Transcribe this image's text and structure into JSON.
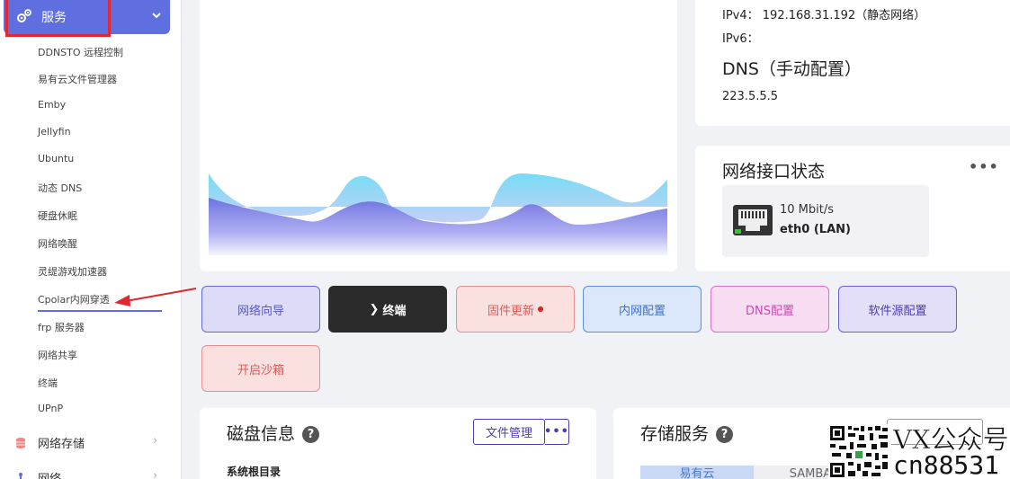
{
  "sidebar": {
    "active_label": "服务",
    "sub_items": [
      "DDNSTO 远程控制",
      "易有云文件管理器",
      "Emby",
      "Jellyfin",
      "Ubuntu",
      "动态 DNS",
      "硬盘休眠",
      "网络唤醒",
      "灵缇游戏加速器",
      "Cpolar内网穿透",
      "frp 服务器",
      "网络共享",
      "终端",
      "UPnP"
    ],
    "groups": [
      "网络存储",
      "网络"
    ],
    "selected_item": "Cpolar内网穿透",
    "accent_color": "#5f6fe0"
  },
  "ip_card": {
    "ipv4_label": "IPv4：",
    "ipv4_value": "192.168.31.192（静态网络）",
    "ipv6_label": "IPv6：",
    "dns_title": "DNS（手动配置）",
    "dns_value": "223.5.5.5"
  },
  "net_card": {
    "title": "网络接口状态",
    "more": "•••",
    "speed": "10 Mbit/s",
    "iface": "eth0 (LAN)"
  },
  "actions": {
    "wizard": "网络向导",
    "terminal": "终端",
    "terminal_prefix": "❯",
    "firmware": "固件更新",
    "lan": "内网配置",
    "dns": "DNS配置",
    "source": "软件源配置",
    "sandbox": "开启沙箱"
  },
  "disk_card": {
    "title": "磁盘信息",
    "help": "?",
    "file_manager": "文件管理",
    "more": "•••",
    "root_dir": "系统根目录"
  },
  "storage_card": {
    "title": "存储服务",
    "help": "?",
    "tab1": "易有云",
    "tab2": "SAMBA"
  },
  "watermark": {
    "line1": "VX公众号",
    "line2": "cn88531"
  }
}
